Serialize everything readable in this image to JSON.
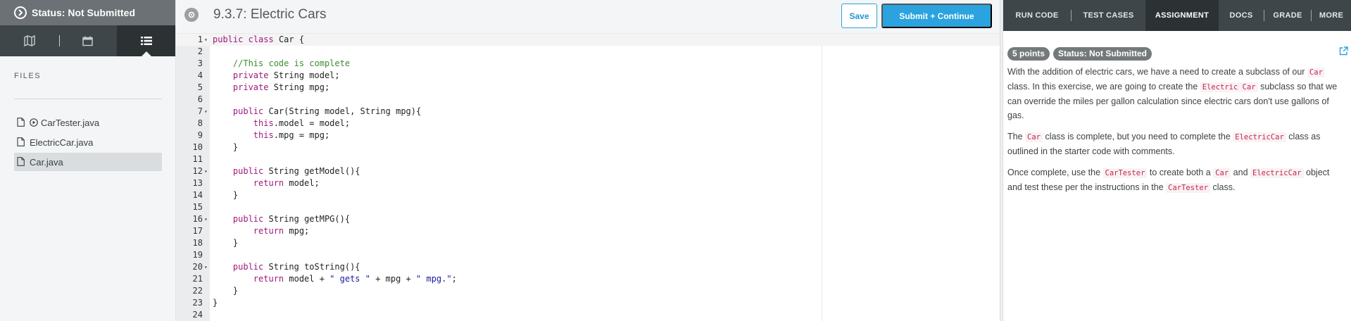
{
  "sidebar": {
    "status": "Status: Not Submitted",
    "files_label": "FILES",
    "files": [
      {
        "name": "CarTester.java",
        "runnable": true
      },
      {
        "name": "ElectricCar.java",
        "runnable": false
      },
      {
        "name": "Car.java",
        "runnable": false,
        "active": true
      }
    ]
  },
  "editor": {
    "title": "9.3.7: Electric Cars",
    "save_label": "Save",
    "submit_label": "Submit + Continue",
    "lines": [
      {
        "n": "1",
        "fold": true,
        "text": "public class Car {"
      },
      {
        "n": "2",
        "fold": false,
        "text": ""
      },
      {
        "n": "3",
        "fold": false,
        "text": "    //This code is complete"
      },
      {
        "n": "4",
        "fold": false,
        "text": "    private String model;"
      },
      {
        "n": "5",
        "fold": false,
        "text": "    private String mpg;"
      },
      {
        "n": "6",
        "fold": false,
        "text": ""
      },
      {
        "n": "7",
        "fold": true,
        "text": "    public Car(String model, String mpg){"
      },
      {
        "n": "8",
        "fold": false,
        "text": "        this.model = model;"
      },
      {
        "n": "9",
        "fold": false,
        "text": "        this.mpg = mpg;"
      },
      {
        "n": "10",
        "fold": false,
        "text": "    }"
      },
      {
        "n": "11",
        "fold": false,
        "text": ""
      },
      {
        "n": "12",
        "fold": true,
        "text": "    public String getModel(){"
      },
      {
        "n": "13",
        "fold": false,
        "text": "        return model;"
      },
      {
        "n": "14",
        "fold": false,
        "text": "    }"
      },
      {
        "n": "15",
        "fold": false,
        "text": ""
      },
      {
        "n": "16",
        "fold": true,
        "text": "    public String getMPG(){"
      },
      {
        "n": "17",
        "fold": false,
        "text": "        return mpg;"
      },
      {
        "n": "18",
        "fold": false,
        "text": "    }"
      },
      {
        "n": "19",
        "fold": false,
        "text": ""
      },
      {
        "n": "20",
        "fold": true,
        "text": "    public String toString(){"
      },
      {
        "n": "21",
        "fold": false,
        "text": "        return model + \" gets \" + mpg + \" mpg.\";"
      },
      {
        "n": "22",
        "fold": false,
        "text": "    }"
      },
      {
        "n": "23",
        "fold": false,
        "text": "}"
      },
      {
        "n": "24",
        "fold": false,
        "text": ""
      }
    ]
  },
  "panel": {
    "tabs": [
      "RUN CODE",
      "TEST CASES",
      "ASSIGNMENT",
      "DOCS",
      "GRADE",
      "MORE"
    ],
    "active_tab": "ASSIGNMENT",
    "points_badge": "5 points",
    "status_badge": "Status: Not Submitted",
    "p1": {
      "t1": "With the addition of electric cars, we have a need to create a subclass of our ",
      "c1": "Car",
      "t2": " class. In this exercise, we are going to create the ",
      "c2": "Electric Car",
      "t3": " subclass so that we can override the miles per gallon calculation since electric cars don't use gallons of gas."
    },
    "p2": {
      "t1": "The ",
      "c1": "Car",
      "t2": " class is complete, but you need to complete the ",
      "c2": "ElectricCar",
      "t3": " class as outlined in the starter code with comments."
    },
    "p3": {
      "t1": "Once complete, use the ",
      "c1": "CarTester",
      "t2": " to create both a ",
      "c2": "Car",
      "t3": " and ",
      "c3": "ElectricCar",
      "t4": " object and test these per the instructions in the ",
      "c4": "CarTester",
      "t5": " class."
    }
  },
  "colors": {
    "accent": "#2aa3de",
    "keyword": "#a0197a",
    "comment": "#3c8d2f",
    "string": "#1a1aa6",
    "dark_nav": "#3f4649"
  }
}
